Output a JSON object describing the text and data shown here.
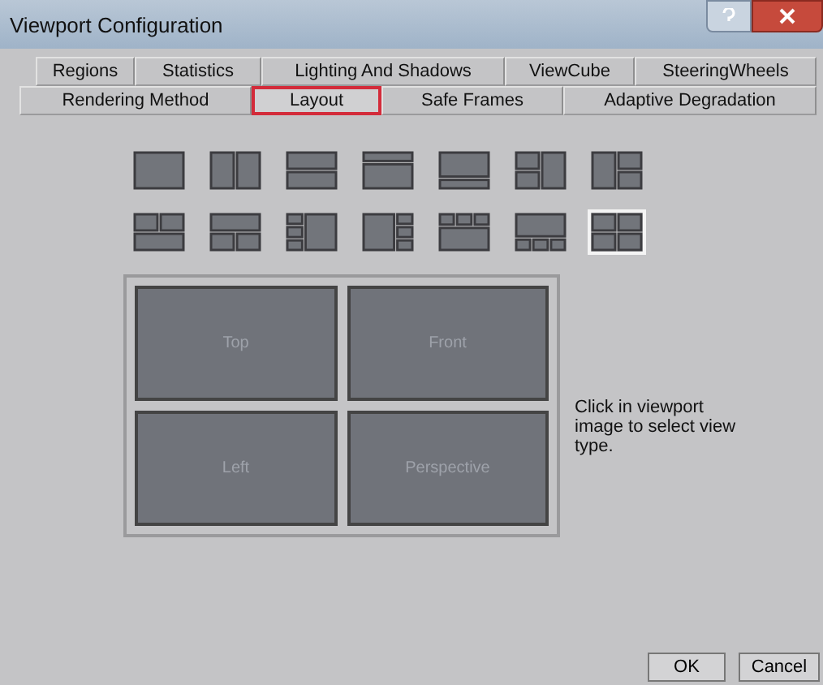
{
  "window": {
    "title": "Viewport Configuration"
  },
  "tab_rows": [
    [
      {
        "label": "Regions",
        "selected": false
      },
      {
        "label": "Statistics",
        "selected": false
      },
      {
        "label": "Lighting And Shadows",
        "selected": false
      },
      {
        "label": "ViewCube",
        "selected": false
      },
      {
        "label": "SteeringWheels",
        "selected": false
      }
    ],
    [
      {
        "label": "Rendering Method",
        "selected": false
      },
      {
        "label": "Layout",
        "selected": true
      },
      {
        "label": "Safe Frames",
        "selected": false
      },
      {
        "label": "Adaptive Degradation",
        "selected": false
      }
    ]
  ],
  "layouts": [
    {
      "kind": "single",
      "selected": false
    },
    {
      "kind": "vsplit",
      "selected": false
    },
    {
      "kind": "hsplit",
      "selected": false
    },
    {
      "kind": "topsmall",
      "selected": false
    },
    {
      "kind": "bottomsmall",
      "selected": false
    },
    {
      "kind": "leftpair",
      "selected": false
    },
    {
      "kind": "rightpair",
      "selected": false
    },
    {
      "kind": "toppair",
      "selected": false
    },
    {
      "kind": "bottompair",
      "selected": false
    },
    {
      "kind": "leftthree",
      "selected": false
    },
    {
      "kind": "rightthree",
      "selected": false
    },
    {
      "kind": "topthree",
      "selected": false
    },
    {
      "kind": "bottomthree",
      "selected": false
    },
    {
      "kind": "quad",
      "selected": true
    }
  ],
  "viewports": [
    "Top",
    "Front",
    "Left",
    "Perspective"
  ],
  "hint": "Click in viewport image to select view type.",
  "buttons": [
    "OK",
    "Cancel"
  ]
}
